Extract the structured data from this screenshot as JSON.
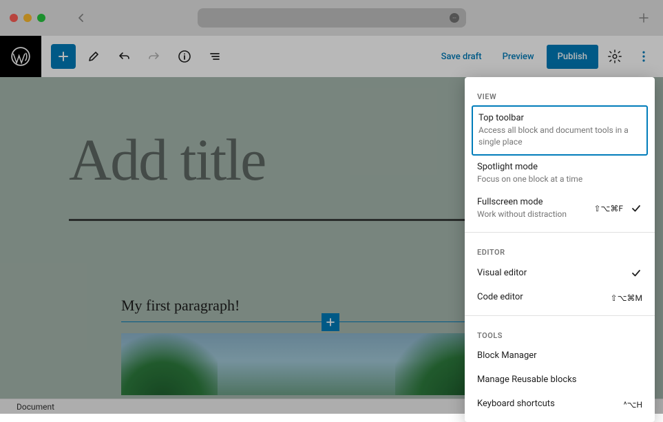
{
  "toolbar": {
    "save_draft": "Save draft",
    "preview": "Preview",
    "publish": "Publish"
  },
  "editor": {
    "title_placeholder": "Add title",
    "paragraph_text": "My first paragraph!"
  },
  "statusbar": {
    "breadcrumb": "Document"
  },
  "dropdown": {
    "sections": {
      "view": {
        "header": "VIEW",
        "items": [
          {
            "title": "Top toolbar",
            "desc": "Access all block and document tools in a single place",
            "highlighted": true
          },
          {
            "title": "Spotlight mode",
            "desc": "Focus on one block at a time"
          },
          {
            "title": "Fullscreen mode",
            "desc": "Work without distraction",
            "shortcut": "⇧⌥⌘F",
            "checked": true
          }
        ]
      },
      "editor": {
        "header": "EDITOR",
        "items": [
          {
            "title": "Visual editor",
            "checked": true
          },
          {
            "title": "Code editor",
            "shortcut": "⇧⌥⌘M"
          }
        ]
      },
      "tools": {
        "header": "TOOLS",
        "items": [
          {
            "title": "Block Manager"
          },
          {
            "title": "Manage Reusable blocks"
          },
          {
            "title": "Keyboard shortcuts",
            "shortcut": "^⌥H"
          }
        ]
      }
    }
  }
}
